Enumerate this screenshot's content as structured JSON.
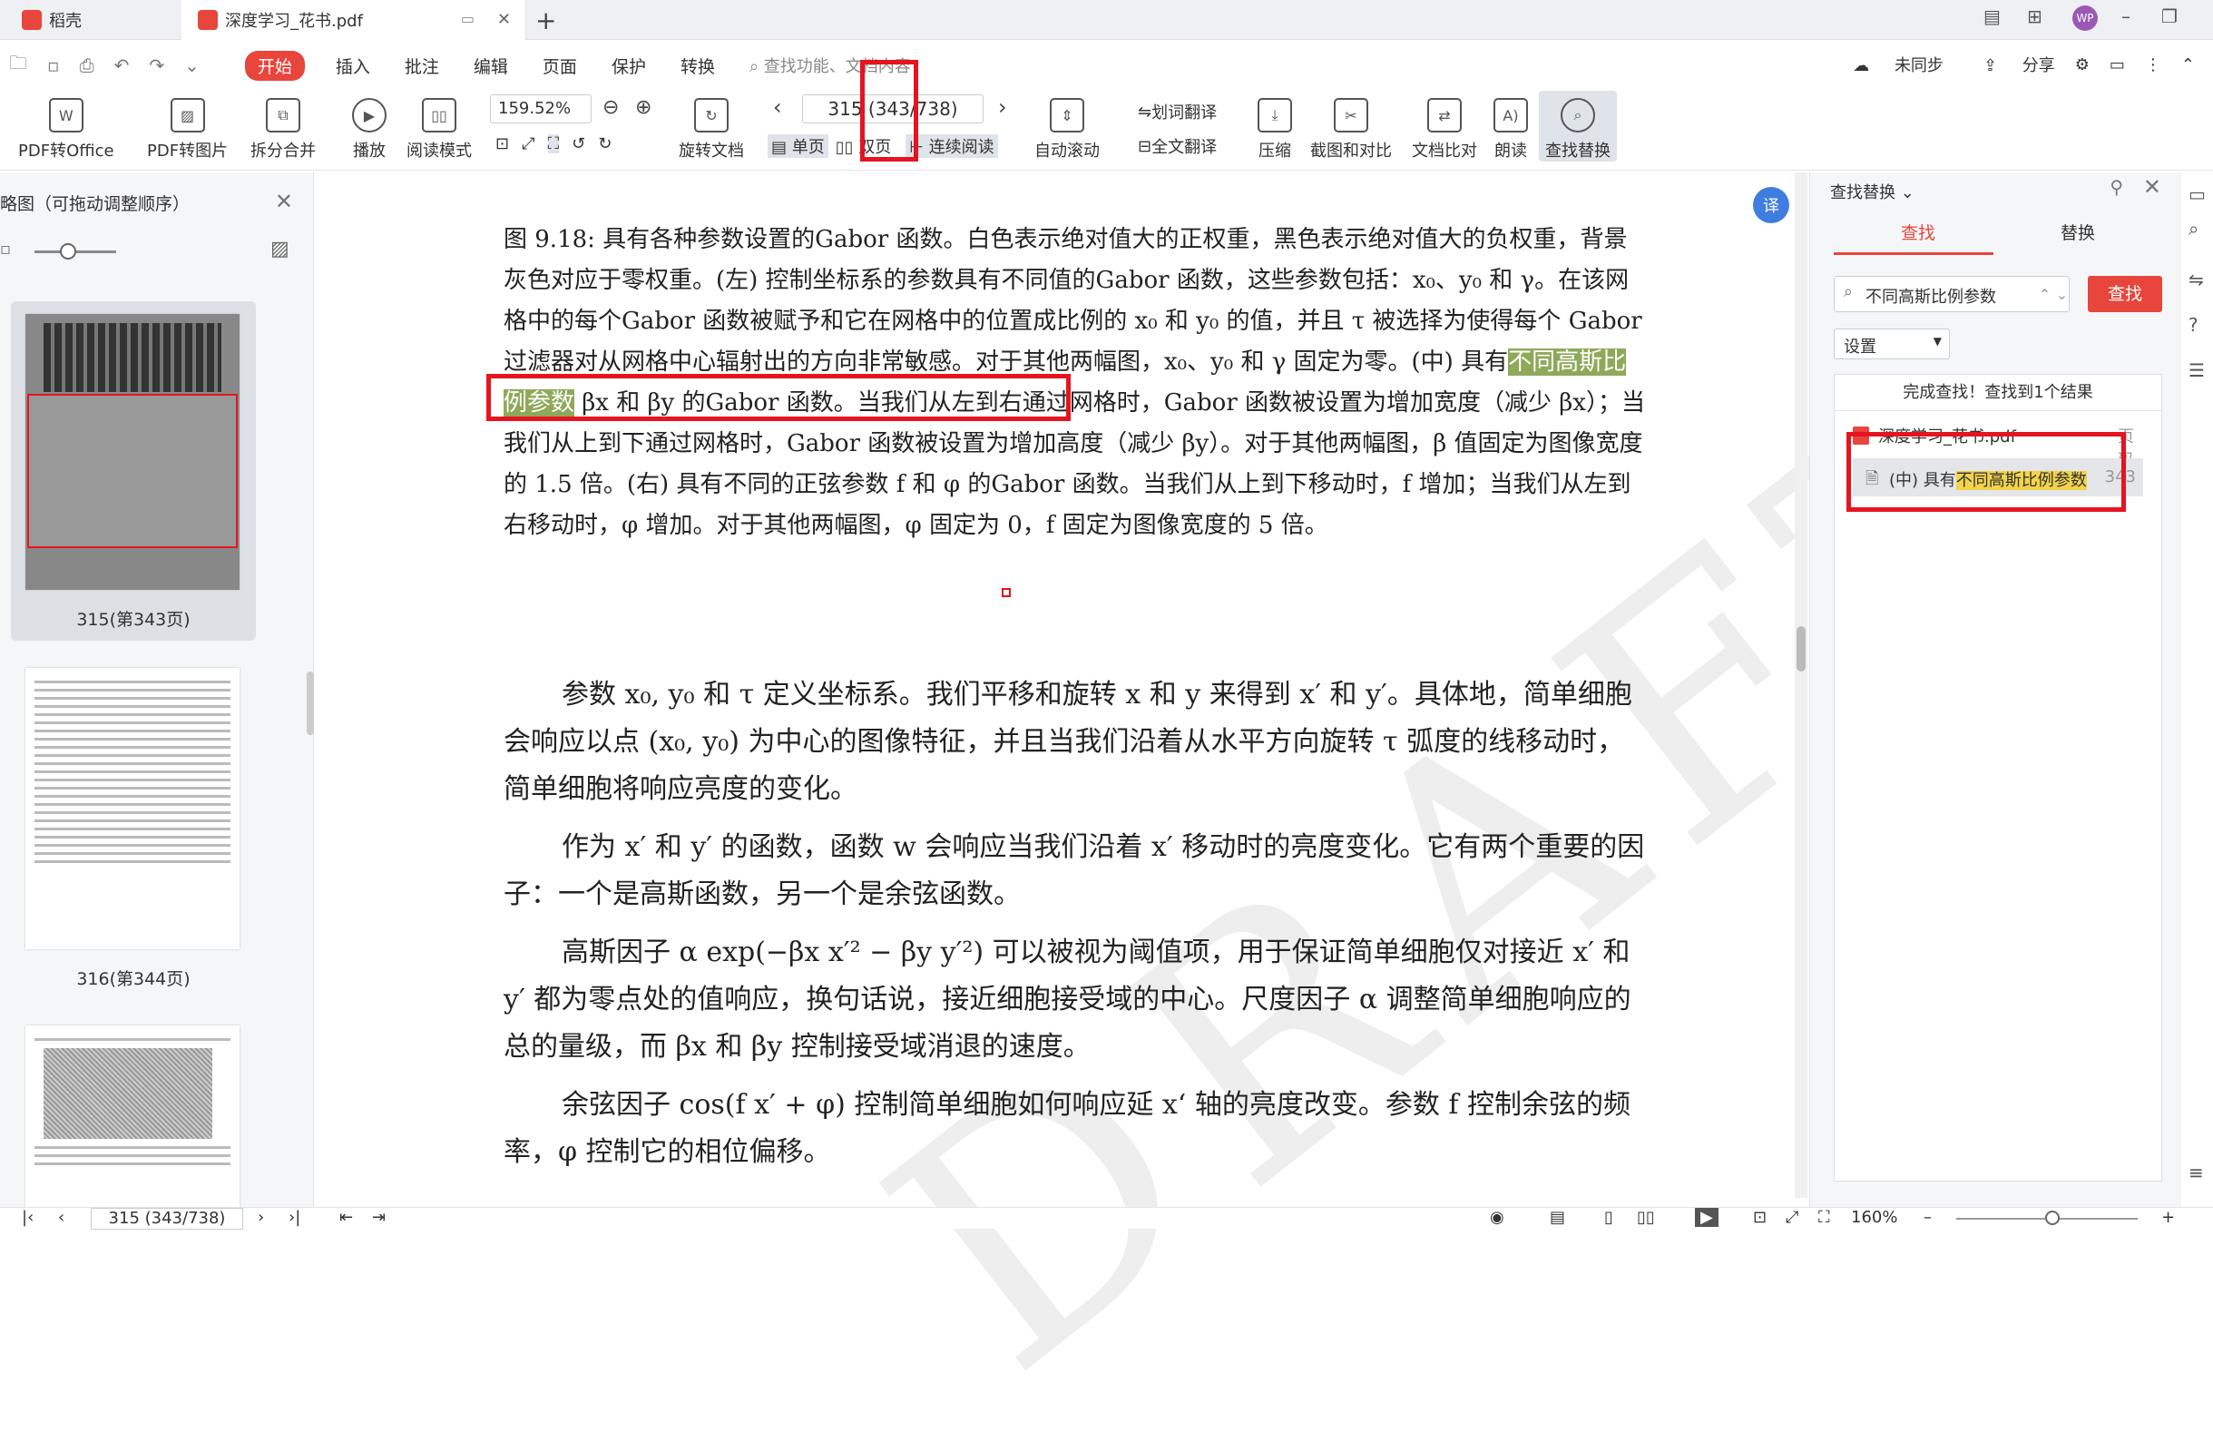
{
  "tabs": [
    {
      "label": "稻壳"
    },
    {
      "label": "深度学习_花书.pdf"
    }
  ],
  "menu": {
    "start": "开始",
    "items": [
      "插入",
      "批注",
      "编辑",
      "页面",
      "保护",
      "转换"
    ],
    "search_placeholder": "查找功能、文档内容",
    "right": [
      "未同步",
      "分享"
    ]
  },
  "toolbar": {
    "pdf_office": "PDF转Office",
    "pdf_image": "PDF转图片",
    "split_merge": "拆分合并",
    "play": "播放",
    "read_mode": "阅读模式",
    "zoom": "159.52%",
    "rotate": "旋转文档",
    "page_value": "315 (343/738)",
    "single": "单页",
    "double": "双页",
    "continuous": "连续阅读",
    "autoscroll": "自动滚动",
    "word_translate": "划词翻译",
    "full_translate": "全文翻译",
    "compress": "压缩",
    "screenshot": "截图和对比",
    "compare": "文档比对",
    "read_aloud": "朗读",
    "find_replace": "查找替换"
  },
  "left_panel": {
    "title": "略图（可拖动调整顺序）",
    "thumbs": [
      {
        "label": "315(第343页)"
      },
      {
        "label": "316(第344页)"
      }
    ]
  },
  "document": {
    "caption_pre": "图 9.18: 具有各种参数设置的Gabor 函数。白色表示绝对值大的正权重，黑色表示绝对值大的负权重，背景灰色对应于零权重。(左) 控制坐标系的参数具有不同值的Gabor 函数，这些参数包括：x₀、y₀ 和 γ。在该网格中的每个Gabor 函数被赋予和它在网格中的位置成比例的 x₀ 和 y₀ 的值，并且 τ 被选择为使得每个 Gabor 过滤器对从网格中心辐射出的方向非常敏感。对于其他两幅图，x₀、y₀ 和 γ 固定为零。(中) 具有",
    "caption_highlight": "不同高斯比例参数",
    "caption_post": " βx 和 βy 的Gabor 函数。当我们从左到右通过网格时，Gabor 函数被设置为增加宽度（减少 βx）；当我们从上到下通过网格时，Gabor 函数被设置为增加高度（减少 βy）。对于其他两幅图，β 值固定为图像宽度的 1.5 倍。(右) 具有不同的正弦参数 f 和 φ 的Gabor 函数。当我们从上到下移动时，f 增加；当我们从左到右移动时，φ 增加。对于其他两幅图，φ 固定为 0，f 固定为图像宽度的 5 倍。",
    "paragraphs": [
      "参数 x₀, y₀ 和 τ 定义坐标系。我们平移和旋转 x 和 y 来得到 x′ 和 y′。具体地，简单细胞会响应以点 (x₀, y₀) 为中心的图像特征，并且当我们沿着从水平方向旋转 τ 弧度的线移动时，简单细胞将响应亮度的变化。",
      "作为 x′ 和 y′ 的函数，函数 w 会响应当我们沿着 x′ 移动时的亮度变化。它有两个重要的因子：一个是高斯函数，另一个是余弦函数。",
      "高斯因子 α exp(−βx x′² − βy y′²) 可以被视为阈值项，用于保证简单细胞仅对接近 x′ 和 y′ 都为零点处的值响应，换句话说，接近细胞接受域的中心。尺度因子 α 调整简单细胞响应的总的量级，而 βx 和 βy 控制接受域消退的速度。",
      "余弦因子 cos(f x′ + φ) 控制简单细胞如何响应延 x‘ 轴的亮度改变。参数 f 控制余弦的频率，φ 控制它的相位偏移。"
    ],
    "watermark": "DRAFT"
  },
  "find_panel": {
    "title": "查找替换",
    "tab_find": "查找",
    "tab_replace": "替换",
    "query": "不同高斯比例参数",
    "find_button": "查找",
    "settings": "设置",
    "status": "完成查找！查找到1个结果",
    "file_name": "深度学习_花书.pdf",
    "file_page_label": "页码",
    "result_pre": "(中) 具有",
    "result_highlight": "不同高斯比例参数",
    "result_page": "343"
  },
  "statusbar": {
    "page_value": "315 (343/738)",
    "zoom": "160%"
  },
  "colors": {
    "accent": "#e8453c",
    "annotation_red": "#e5141f",
    "highlight_green": "#8fa95a",
    "highlight_yellow": "#f3d34a"
  }
}
